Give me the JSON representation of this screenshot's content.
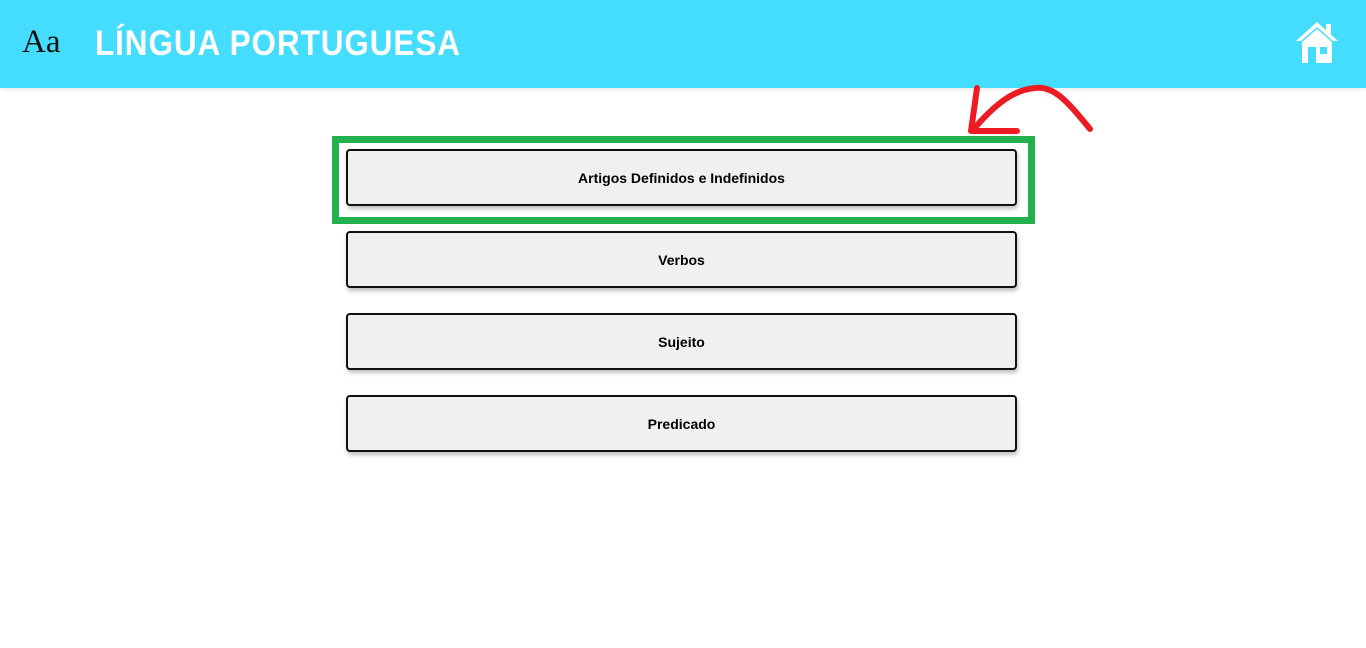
{
  "header": {
    "logo": "Aa",
    "title": "LÍNGUA PORTUGUESA",
    "home_icon": "home-icon"
  },
  "menu": {
    "items": [
      {
        "label": "Artigos Definidos e Indefinidos"
      },
      {
        "label": "Verbos"
      },
      {
        "label": "Sujeito"
      },
      {
        "label": "Predicado"
      }
    ]
  },
  "annotation": {
    "highlight_color": "#22b14c",
    "arrow_color": "#ed1c24"
  }
}
